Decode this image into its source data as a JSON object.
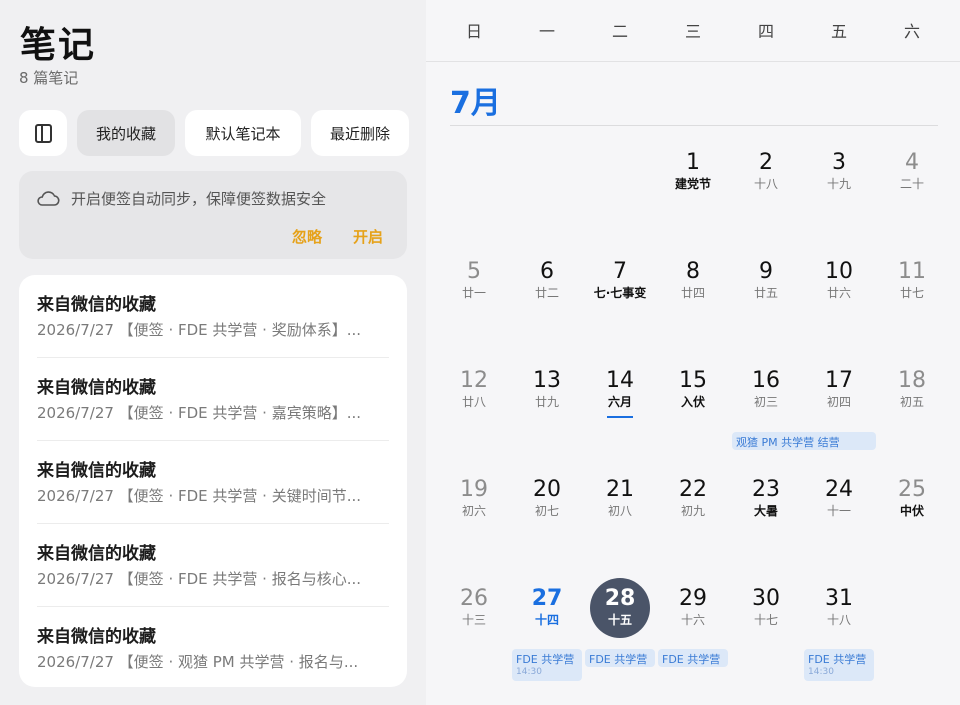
{
  "notes_app": {
    "title": "笔记",
    "count_label": "8 篇笔记",
    "tabs": {
      "sidebar_icon": "sidebar-panel-icon",
      "favorites": "我的收藏",
      "default_notebook": "默认笔记本",
      "recently_deleted": "最近删除"
    },
    "sync_banner": {
      "icon": "cloud-icon",
      "text": "开启便签自动同步，保障便签数据安全",
      "ignore_label": "忽略",
      "enable_label": "开启",
      "accent": "#e6a21a"
    },
    "notes": [
      {
        "title": "来自微信的收藏",
        "subtitle": "2026/7/27 【便签 · FDE 共学营 · 奖励体系】..."
      },
      {
        "title": "来自微信的收藏",
        "subtitle": "2026/7/27 【便签 · FDE 共学营 · 嘉宾策略】..."
      },
      {
        "title": "来自微信的收藏",
        "subtitle": "2026/7/27 【便签 · FDE 共学营 · 关键时间节..."
      },
      {
        "title": "来自微信的收藏",
        "subtitle": "2026/7/27 【便签 · FDE 共学营 · 报名与核心..."
      },
      {
        "title": "来自微信的收藏",
        "subtitle": "2026/7/27 【便签 · 观猹 PM 共学营 · 报名与..."
      }
    ]
  },
  "calendar": {
    "weekdays": [
      "日",
      "一",
      "二",
      "三",
      "四",
      "五",
      "六"
    ],
    "month_label": "7月",
    "accent": "#1a6fe0",
    "weeks": [
      [
        null,
        null,
        null,
        {
          "d": "1",
          "l": "建党节",
          "b": true
        },
        {
          "d": "2",
          "l": "十八"
        },
        {
          "d": "3",
          "l": "十九"
        },
        {
          "d": "4",
          "l": "二十"
        }
      ],
      [
        {
          "d": "5",
          "l": "廿一"
        },
        {
          "d": "6",
          "l": "廿二"
        },
        {
          "d": "7",
          "l": "七·七事变",
          "b": true
        },
        {
          "d": "8",
          "l": "廿四"
        },
        {
          "d": "9",
          "l": "廿五"
        },
        {
          "d": "10",
          "l": "廿六"
        },
        {
          "d": "11",
          "l": "廿七"
        }
      ],
      [
        {
          "d": "12",
          "l": "廿八"
        },
        {
          "d": "13",
          "l": "廿九"
        },
        {
          "d": "14",
          "l": "六月",
          "b": true
        },
        {
          "d": "15",
          "l": "入伏",
          "b": true
        },
        {
          "d": "16",
          "l": "初三"
        },
        {
          "d": "17",
          "l": "初四"
        },
        {
          "d": "18",
          "l": "初五"
        }
      ],
      [
        {
          "d": "19",
          "l": "初六"
        },
        {
          "d": "20",
          "l": "初七"
        },
        {
          "d": "21",
          "l": "初八"
        },
        {
          "d": "22",
          "l": "初九"
        },
        {
          "d": "23",
          "l": "大暑",
          "b": true
        },
        {
          "d": "24",
          "l": "十一"
        },
        {
          "d": "25",
          "l": "中伏",
          "b": true
        }
      ],
      [
        {
          "d": "26",
          "l": "十三"
        },
        {
          "d": "27",
          "l": "十四"
        },
        {
          "d": "28",
          "l": "十五"
        },
        {
          "d": "29",
          "l": "十六"
        },
        {
          "d": "30",
          "l": "十七"
        },
        {
          "d": "31",
          "l": "十八"
        },
        null
      ]
    ],
    "today": "27",
    "selected": "28",
    "underlined": "14",
    "events": {
      "camp_end": "观猹 PM 共学营 结营",
      "fde_1": "FDE 共学营",
      "fde_1_time": "14:30",
      "fde_2": "FDE 共学营",
      "fde_3": "FDE 共学营",
      "fde_4": "FDE 共学营",
      "fde_4_time": "14:30"
    }
  }
}
